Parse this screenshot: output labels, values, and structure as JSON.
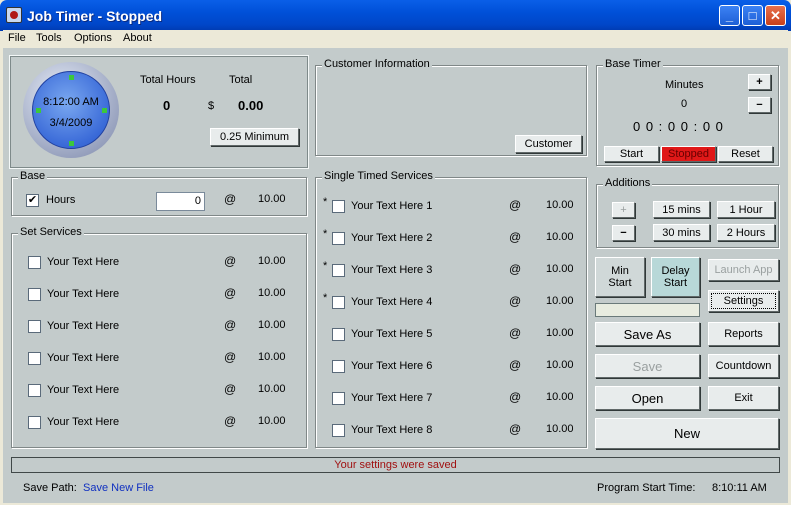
{
  "window": {
    "title": "Job Timer - Stopped"
  },
  "menu": [
    "File",
    "Tools",
    "Options",
    "About"
  ],
  "clock": {
    "time": "8:12:00 AM",
    "date": "3/4/2009"
  },
  "totals": {
    "hours_label": "Total Hours",
    "total_label": "Total",
    "hours_value": "0",
    "currency": "$",
    "total_value": "0.00",
    "minimum_button": "0.25 Minimum"
  },
  "customer": {
    "title": "Customer Information",
    "button": "Customer"
  },
  "base_timer": {
    "title": "Base Timer",
    "minutes_label": "Minutes",
    "minutes_value": "0",
    "display": "0 0 : 0 0 : 0 0",
    "plus": "+",
    "minus": "−",
    "start": "Start",
    "stopped": "Stopped",
    "reset": "Reset",
    "stopped_color": "#e01818"
  },
  "base": {
    "title": "Base",
    "hours_label": "Hours",
    "hours_value": "0",
    "at": "@",
    "rate": "10.00",
    "checked_mark": "✔"
  },
  "set_services": {
    "title": "Set Services",
    "items": [
      {
        "label": "Your Text Here",
        "at": "@",
        "rate": "10.00"
      },
      {
        "label": "Your Text Here",
        "at": "@",
        "rate": "10.00"
      },
      {
        "label": "Your Text Here",
        "at": "@",
        "rate": "10.00"
      },
      {
        "label": "Your Text Here",
        "at": "@",
        "rate": "10.00"
      },
      {
        "label": "Your Text Here",
        "at": "@",
        "rate": "10.00"
      },
      {
        "label": "Your Text Here",
        "at": "@",
        "rate": "10.00"
      }
    ]
  },
  "single_services": {
    "title": "Single Timed Services",
    "items": [
      {
        "star": "*",
        "label": "Your Text Here 1",
        "at": "@",
        "rate": "10.00"
      },
      {
        "star": "*",
        "label": "Your Text Here 2",
        "at": "@",
        "rate": "10.00"
      },
      {
        "star": "*",
        "label": "Your Text Here 3",
        "at": "@",
        "rate": "10.00"
      },
      {
        "star": "*",
        "label": "Your Text Here 4",
        "at": "@",
        "rate": "10.00"
      },
      {
        "star": "",
        "label": "Your Text Here 5",
        "at": "@",
        "rate": "10.00"
      },
      {
        "star": "",
        "label": "Your Text Here 6",
        "at": "@",
        "rate": "10.00"
      },
      {
        "star": "",
        "label": "Your Text Here 7",
        "at": "@",
        "rate": "10.00"
      },
      {
        "star": "",
        "label": "Your Text Here 8",
        "at": "@",
        "rate": "10.00"
      }
    ]
  },
  "additions": {
    "title": "Additions",
    "plus": "+",
    "minus": "−",
    "b15": "15 mins",
    "b1h": "1 Hour",
    "b30": "30 mins",
    "b2h": "2 Hours"
  },
  "controls": {
    "min_start": [
      "Min",
      "Start"
    ],
    "delay_start": [
      "Delay",
      "Start"
    ],
    "launch_app": "Launch App",
    "settings": "Settings",
    "save_as": "Save As",
    "reports": "Reports",
    "save": "Save",
    "countdown": "Countdown",
    "open": "Open",
    "exit": "Exit",
    "new": "New"
  },
  "status": {
    "message": "Your settings were saved",
    "color": "#a01010"
  },
  "footer": {
    "save_path_label": "Save Path:",
    "save_path_value": "Save New File",
    "start_time_label": "Program Start Time:",
    "start_time_value": "8:10:11 AM",
    "link_color": "#1030c0"
  }
}
